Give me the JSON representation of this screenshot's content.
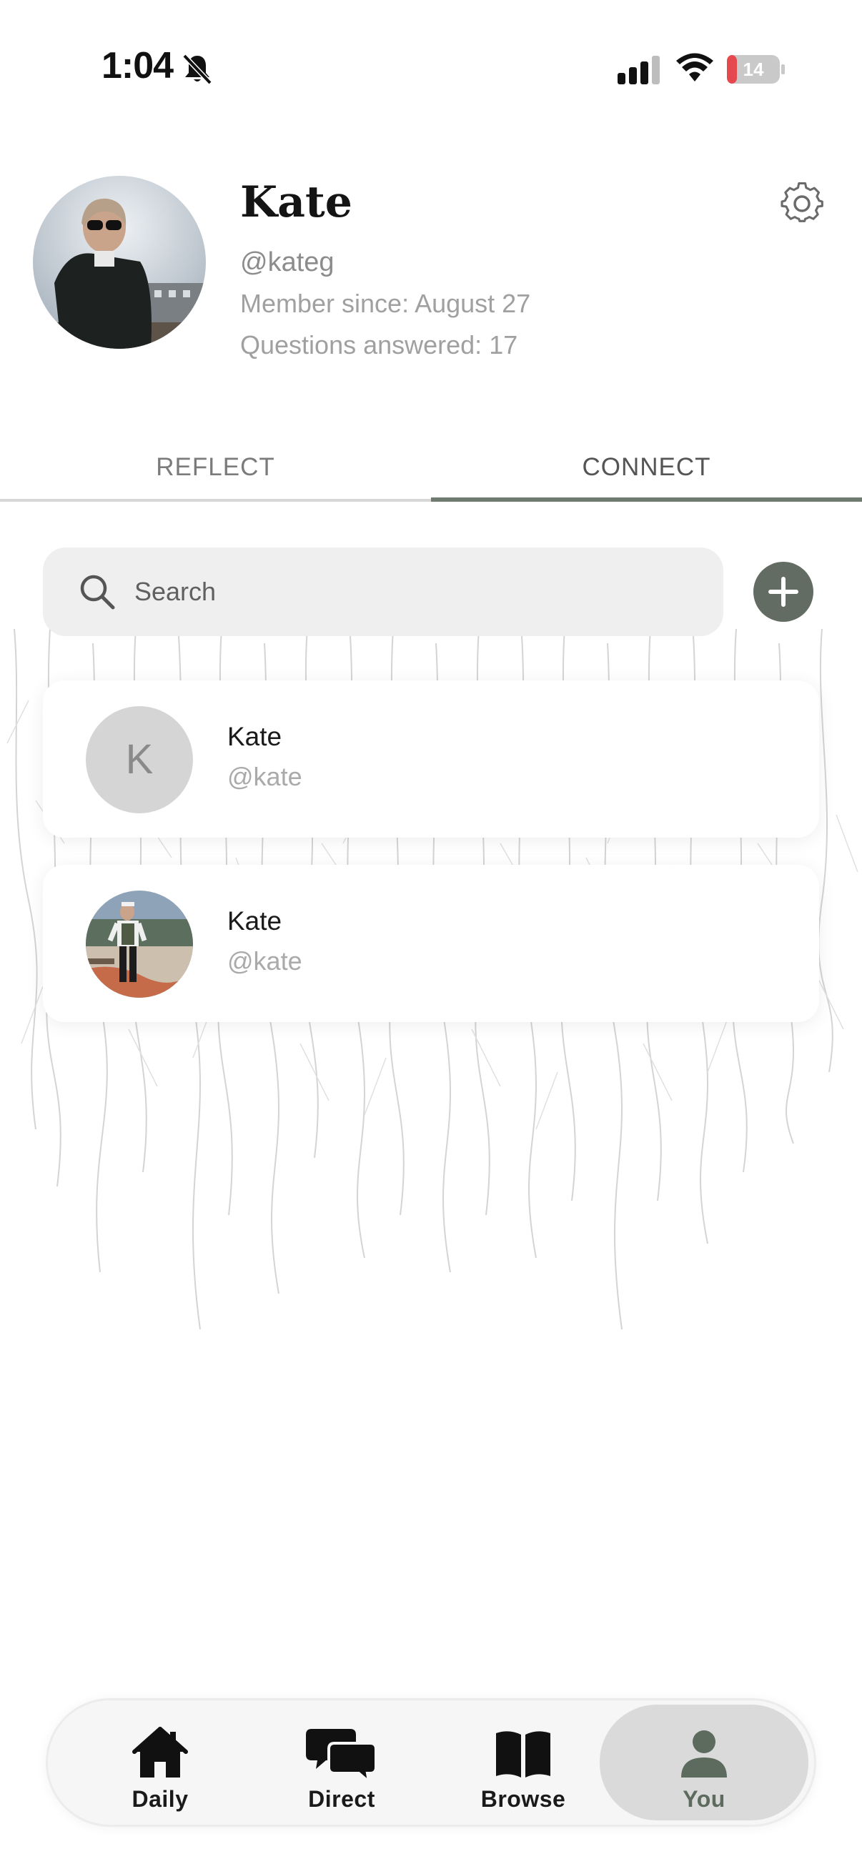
{
  "status_bar": {
    "time": "1:04",
    "battery_level": "14",
    "icons": [
      "bell-slash-icon",
      "cellular-signal-icon",
      "wifi-icon",
      "battery-icon"
    ]
  },
  "profile": {
    "name": "Kate",
    "handle": "@kateg",
    "member_since": "Member since: August 27",
    "questions_answered": "Questions answered: 17",
    "settings_icon": "gear-icon"
  },
  "tabs": [
    {
      "label": "REFLECT",
      "active": false
    },
    {
      "label": "CONNECT",
      "active": true
    }
  ],
  "search": {
    "placeholder": "Search",
    "value": ""
  },
  "connections": [
    {
      "name": "Kate",
      "handle": "@kate",
      "initial": "K",
      "has_photo": false
    },
    {
      "name": "Kate",
      "handle": "@kate",
      "initial": "",
      "has_photo": true
    }
  ],
  "bottom_nav": [
    {
      "label": "Daily",
      "icon": "home-icon",
      "active": false
    },
    {
      "label": "Direct",
      "icon": "chat-bubbles-icon",
      "active": false
    },
    {
      "label": "Browse",
      "icon": "book-icon",
      "active": false
    },
    {
      "label": "You",
      "icon": "person-icon",
      "active": true
    }
  ],
  "colors": {
    "accent": "#626c63",
    "active_tab_underline": "#6f7b70",
    "active_nav_bg": "#dadada",
    "battery_low": "#e5484d"
  }
}
